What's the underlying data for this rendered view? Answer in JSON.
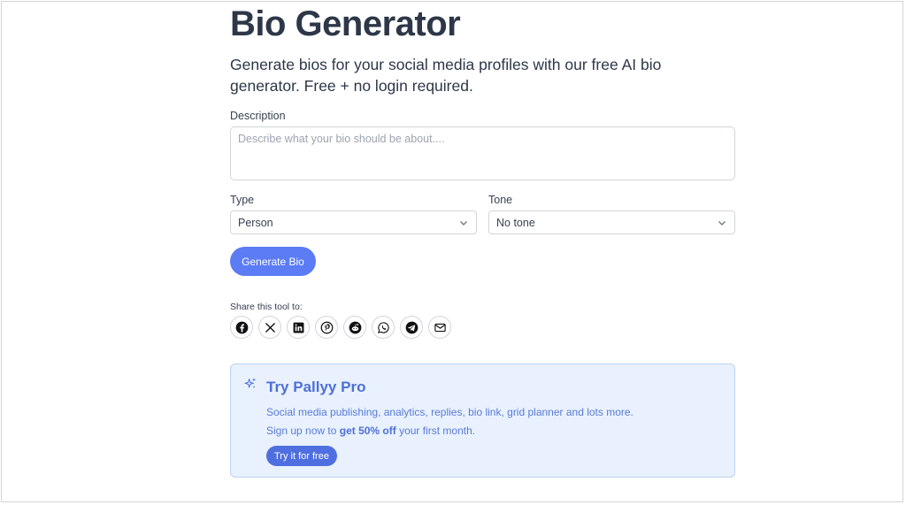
{
  "page": {
    "title": "Bio Generator",
    "subtitle": "Generate bios for your social media profiles with our free AI bio generator. Free + no login required."
  },
  "form": {
    "description_label": "Description",
    "description_placeholder": "Describe what your bio should be about....",
    "description_value": "",
    "type_label": "Type",
    "type_value": "Person",
    "tone_label": "Tone",
    "tone_value": "No tone",
    "generate_button": "Generate Bio"
  },
  "share": {
    "label": "Share this tool to:",
    "icons": [
      "facebook-icon",
      "x-icon",
      "linkedin-icon",
      "pinterest-icon",
      "reddit-icon",
      "whatsapp-icon",
      "telegram-icon",
      "email-icon"
    ]
  },
  "promo": {
    "title": "Try Pallyy Pro",
    "line1": "Social media publishing, analytics, replies, bio link, grid planner and lots more.",
    "line2_prefix": "Sign up now to ",
    "line2_bold": "get 50% off",
    "line2_suffix": " your first month.",
    "button": "Try it for free",
    "icon": "sparkles-icon"
  },
  "colors": {
    "accent": "#5b7cf4",
    "promo_bg": "#e8f1fd",
    "promo_text": "#5b7ad6",
    "heading": "#2d3748"
  }
}
